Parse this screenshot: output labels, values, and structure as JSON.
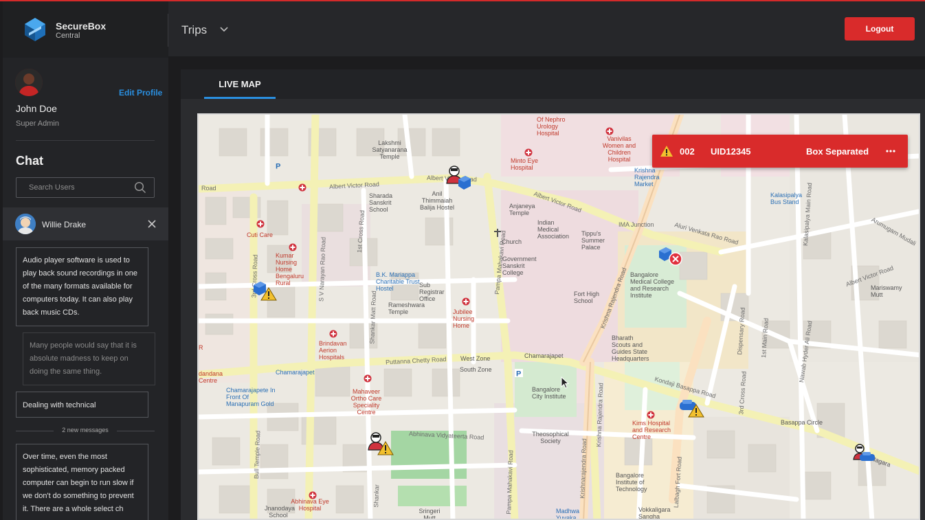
{
  "brand": {
    "name": "SecureBox",
    "sub": "Central",
    "accent": "#2a8fe0"
  },
  "profile": {
    "edit_label": "Edit Profile",
    "name": "John Doe",
    "role": "Super Admin"
  },
  "chat": {
    "title": "Chat",
    "search_placeholder": "Search Users",
    "active_user": "Willie Drake",
    "messages": [
      "Audio player software is used to play back sound recordings in one of the many formats available for computers today. It can also play back music CDs.",
      "Many people would say that it is absolute madness to keep on doing the same thing.",
      "Dealing with technical",
      "Over time, even the most sophisticated, memory packed computer can begin to run slow if we don't do something to prevent it. There are a whole select ch"
    ],
    "new_messages_label": "2 new messages"
  },
  "header": {
    "section": "Trips",
    "logout_label": "Logout",
    "logout_color": "#d92b2b"
  },
  "tabs": {
    "live_map": "LIVE MAP"
  },
  "alert": {
    "id": "002",
    "uid": "UID12345",
    "status": "Box Separated",
    "color": "#d92b2b"
  },
  "map": {
    "labels": {
      "albert_victor_1": "Albert Victor Road",
      "albert_victor_2": "Albert Victor Road",
      "albert_victor_3": "Albert Victor Road",
      "road_left": "Road",
      "puttanna": "Puttanna Chetty Road",
      "kondaji": "Kondaji Basappa Road",
      "abhinava": "Abhinava Vidyateerta Road",
      "aluri": "Aluri Venkata Rao Road",
      "ima": "IMA Junction",
      "krishna_1": "Krishna Rajendra Road",
      "krishna_2": "Krishna Rajendra Road",
      "krishnarajendra": "Krishnarajendra Road",
      "pampa": "Pampa Mahakavi Road",
      "pampa_2": "Pampa Mahakavi Road",
      "shankar": "Shankar Matt Road",
      "shankar_2": "Shankar",
      "first_cross": "1st Cross Road",
      "third_cross": "3rd Cross Road",
      "third_cross_r": "3rd Cross Road",
      "sv_narayan": "S V Narayan Rao Road",
      "bull_temple": "Bull Temple Road",
      "lalbagh": "Lalbagh Fort Road",
      "dispensary": "Dispensary Road",
      "first_main": "1st Main Road",
      "nawab": "Nawab Hyder Ali Road",
      "kalasipalya": "Kalasipalya Main Road",
      "albert_victor_r": "Albert Victor Road",
      "arumugam": "Arumugam Mudali",
      "basappa": "Basappa Circle",
      "lakshmi": "Lakshmi Satyanarana Temple",
      "minto": "Minto Eye Hospital",
      "nephro": "Of Nephro Urology Hospital",
      "vanivilas": "Vanivilas Women and Children Hospital",
      "kr_market": "Krishna Rajendra Market",
      "kalasipalya_bus": "Kalasipalya Bus Stand",
      "sharada": "Sharada Sanskrit School",
      "anil": "Anil Thimmaiah Balija Hostel",
      "anjaneya": "Anjaneya Temple",
      "church": "Church",
      "indian_medical": "Indian Medical Association",
      "tippu": "Tippu's Summer Palace",
      "cuti": "Cuti Care",
      "kumar": "Kumar Nursing Home Bengaluru Rural",
      "bk_mariappa": "B.K. Mariappa Charitable Trust Hostel",
      "sub_registrar": "Sub Registrar Office",
      "government": "Government Sanskrit College",
      "fort_high": "Fort High School",
      "bmcri": "Bangalore Medical College and Research Institute",
      "mariswamy": "Mariswamy Mutt",
      "rameshwara": "Rameshwara Temple",
      "jubilee": "Jubilee Nursing Home",
      "brindavan": "Brindavan Aerion Hospitals",
      "bharath": "Bharath Scouts and Guides State Headquarters",
      "west_zone": "West Zone",
      "south_zone": "South Zone",
      "chamarajapet": "Chamarajapet",
      "chamarajapet_2": "Chamarajapet",
      "chamarajapet_in": "Chamarajapete In Front Of Manapuram Gold",
      "mahaveer": "Mahaveer Ortho Care Speciality Centre",
      "bangalore_city": "Bangalore City Institute",
      "theosophical": "Theosophical Society",
      "kims": "Kims Hospital and Research Centre",
      "bit": "Bangalore Institute of Technology",
      "abhinava_eye": "Abhinava Eye Hospital",
      "jnanodaya": "Jnanodaya School",
      "sringeri": "Sringeri Mutt",
      "madhwa": "Madhwa Yuvaka",
      "vokkaligara": "Vokkaligara Sangha",
      "nagara": "Nagara",
      "dandana": "dandana Centre",
      "hospital_r": "R"
    }
  }
}
